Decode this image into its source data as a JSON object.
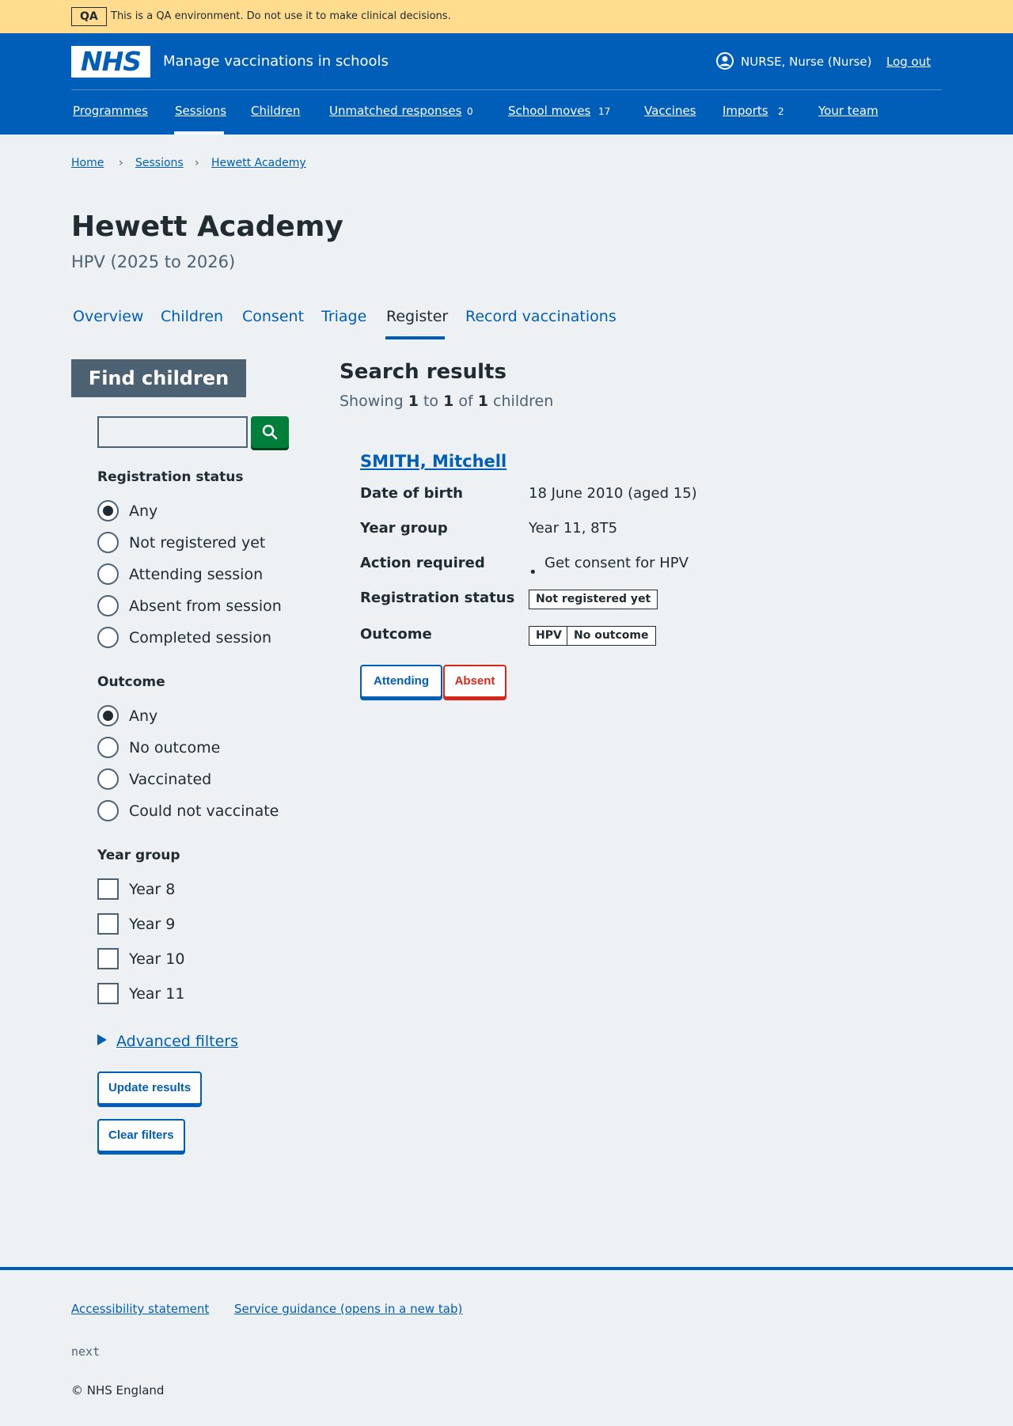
{
  "qa_banner": {
    "tag": "QA",
    "text": "This is a QA environment. Do not use it to make clinical decisions."
  },
  "header": {
    "logo": "NHS",
    "service_name": "Manage vaccinations in schools",
    "user": "NURSE, Nurse (Nurse)",
    "logout": "Log out",
    "nav": [
      {
        "label": "Programmes"
      },
      {
        "label": "Sessions",
        "active": true
      },
      {
        "label": "Children"
      },
      {
        "label": "Unmatched responses",
        "count": "0"
      },
      {
        "label": "School moves",
        "count": "17"
      },
      {
        "label": "Vaccines"
      },
      {
        "label": "Imports",
        "count": "2"
      },
      {
        "label": "Your team"
      }
    ]
  },
  "breadcrumbs": [
    "Home",
    "Sessions",
    "Hewett Academy"
  ],
  "page": {
    "title": "Hewett Academy",
    "caption": "HPV (2025 to 2026)"
  },
  "tabs": [
    {
      "label": "Overview"
    },
    {
      "label": "Children"
    },
    {
      "label": "Consent"
    },
    {
      "label": "Triage"
    },
    {
      "label": "Register",
      "current": true
    },
    {
      "label": "Record vaccinations"
    }
  ],
  "filters": {
    "heading": "Find children",
    "search_value": "",
    "registration": {
      "legend": "Registration status",
      "options": [
        "Any",
        "Not registered yet",
        "Attending session",
        "Absent from session",
        "Completed session"
      ],
      "selected": "Any"
    },
    "outcome": {
      "legend": "Outcome",
      "options": [
        "Any",
        "No outcome",
        "Vaccinated",
        "Could not vaccinate"
      ],
      "selected": "Any"
    },
    "year_group": {
      "legend": "Year group",
      "options": [
        "Year 8",
        "Year 9",
        "Year 10",
        "Year 11"
      ]
    },
    "advanced": "Advanced filters",
    "update_button": "Update results",
    "clear_button": "Clear filters"
  },
  "results": {
    "title": "Search results",
    "showing": "Showing",
    "from": "1",
    "to_word": "to",
    "to": "1",
    "of_word": "of",
    "total": "1",
    "unit": "children",
    "child": {
      "name": "SMITH, Mitchell",
      "rows": [
        {
          "key": "Date of birth",
          "value": "18 June 2010 (aged 15)"
        },
        {
          "key": "Year group",
          "value": "Year 11, 8T5"
        },
        {
          "key": "Action required",
          "value": "Get consent for HPV"
        },
        {
          "key": "Registration status",
          "value": "Not registered yet"
        },
        {
          "key": "Outcome",
          "programme": "HPV",
          "value": "No outcome"
        }
      ],
      "attending_button": "Attending",
      "absent_button": "Absent"
    }
  },
  "footer": {
    "links": [
      "Accessibility statement",
      "Service guidance (opens in a new tab)"
    ],
    "version": "next",
    "copyright": "© NHS England"
  },
  "colors": {
    "brand_blue": "#005eb8",
    "qa_yellow": "#ffdc8e",
    "search_green": "#007f3b",
    "absent_red": "#d5281b"
  }
}
